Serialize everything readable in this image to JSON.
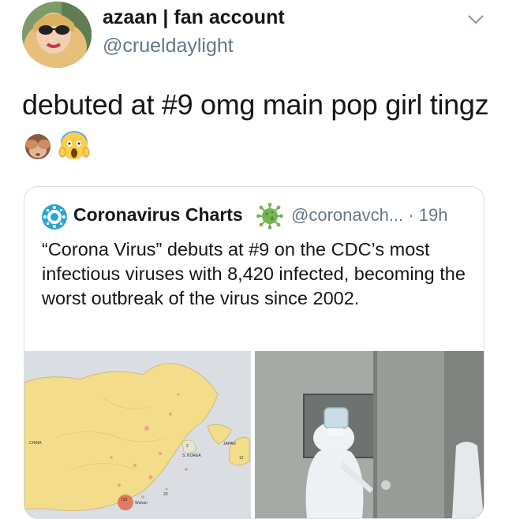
{
  "tweet": {
    "display_name": "azaan | fan account",
    "handle": "@crueldaylight",
    "text": "debuted at #9 omg main pop girl tingz",
    "emojis": [
      "see-no-evil-monkey-icon",
      "screaming-face-icon"
    ]
  },
  "quoted_tweet": {
    "display_name": "Coronavirus Charts",
    "handle_time": "@coronavch... · 19h",
    "text": "“Corona Virus” debuts at #9 on the CDC’s most infectious viruses with 8,420 infected, becoming the worst outbreak of the virus since 2002.",
    "media": {
      "map_labels": [
        "CHINA",
        "JAPAN",
        "S. KOREA",
        "Wuhan",
        "729",
        "20",
        "12",
        "2"
      ]
    }
  },
  "colors": {
    "text": "#14171a",
    "secondary_text": "#657786",
    "border": "#d9dee2",
    "map_land": "#f3dd8a",
    "verified_green": "#77b255"
  }
}
